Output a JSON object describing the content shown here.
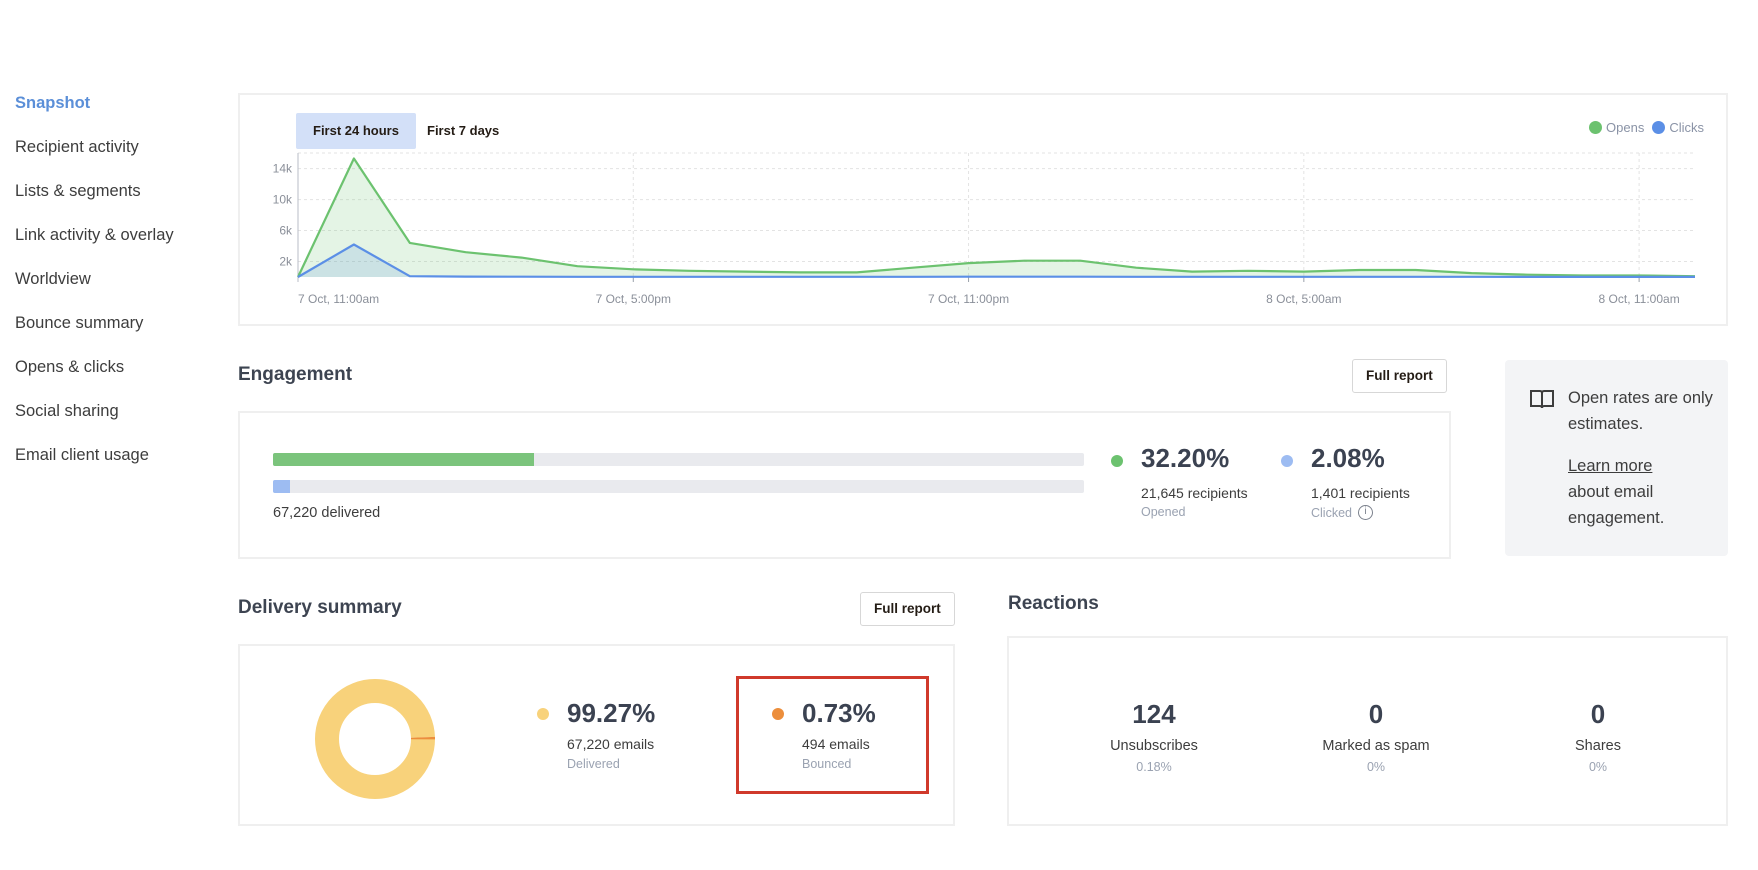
{
  "sidebar": {
    "items": [
      {
        "label": "Snapshot",
        "active": true
      },
      {
        "label": "Recipient activity"
      },
      {
        "label": "Lists & segments"
      },
      {
        "label": "Link activity & overlay"
      },
      {
        "label": "Worldview"
      },
      {
        "label": "Bounce summary"
      },
      {
        "label": "Opens & clicks"
      },
      {
        "label": "Social sharing"
      },
      {
        "label": "Email client usage"
      }
    ]
  },
  "activity_chart": {
    "tabs": [
      {
        "label": "First 24 hours",
        "active": true
      },
      {
        "label": "First 7 days",
        "active": false
      }
    ],
    "legend": [
      {
        "label": "Opens",
        "color": "#6cc26f"
      },
      {
        "label": "Clicks",
        "color": "#5b8fe6"
      }
    ]
  },
  "chart_data": {
    "type": "area",
    "title": "",
    "xlabel": "",
    "ylabel": "",
    "x_tick_labels": [
      "7 Oct, 11:00am",
      "7 Oct, 5:00pm",
      "7 Oct, 11:00pm",
      "8 Oct, 5:00am",
      "8 Oct, 11:00am"
    ],
    "x_tick_hours": [
      0,
      6,
      12,
      18,
      24
    ],
    "y_tick_labels": [
      "2k",
      "6k",
      "10k",
      "14k"
    ],
    "y_ticks": [
      2000,
      6000,
      10000,
      14000
    ],
    "ylim": [
      0,
      15500
    ],
    "x_range_hours": [
      0,
      25
    ],
    "grid": true,
    "legend_position": "top-right",
    "x_hours": [
      0,
      1,
      2,
      3,
      4,
      5,
      6,
      7,
      8,
      9,
      10,
      11,
      12,
      13,
      14,
      15,
      16,
      17,
      18,
      19,
      20,
      21,
      22,
      23,
      24,
      25
    ],
    "series": [
      {
        "name": "Opens",
        "color": "#6cc26f",
        "values": [
          0,
          15300,
          4400,
          3200,
          2500,
          1400,
          1000,
          800,
          700,
          600,
          600,
          1200,
          1800,
          2100,
          2100,
          1200,
          700,
          800,
          700,
          900,
          900,
          500,
          300,
          200,
          200,
          100
        ]
      },
      {
        "name": "Clicks",
        "color": "#5b8fe6",
        "values": [
          0,
          4200,
          100,
          50,
          40,
          30,
          30,
          20,
          20,
          20,
          20,
          30,
          40,
          40,
          40,
          30,
          20,
          20,
          20,
          20,
          20,
          20,
          10,
          10,
          10,
          10
        ]
      }
    ]
  },
  "engagement": {
    "title": "Engagement",
    "full_report_label": "Full report",
    "delivered_text": "67,220 delivered",
    "opened": {
      "pct": "32.20%",
      "fraction": 0.322,
      "recipients": "21,645 recipients",
      "label": "Opened",
      "color": "#6cc26f"
    },
    "clicked": {
      "pct": "2.08%",
      "fraction": 0.0208,
      "recipients": "1,401 recipients",
      "label": "Clicked",
      "color": "#9dbcf2"
    }
  },
  "info_box": {
    "text": "Open rates are only estimates.",
    "link": "Learn more",
    "tail": "about email engagement."
  },
  "delivery": {
    "title": "Delivery summary",
    "full_report_label": "Full report",
    "delivered": {
      "pct": "99.27%",
      "fraction": 0.9927,
      "emails": "67,220 emails",
      "label": "Delivered",
      "color": "#f8d27b"
    },
    "bounced": {
      "pct": "0.73%",
      "fraction": 0.0073,
      "emails": "494 emails",
      "label": "Bounced",
      "color": "#ec8e3c"
    }
  },
  "reactions": {
    "title": "Reactions",
    "items": [
      {
        "value": "124",
        "label": "Unsubscribes",
        "pct": "0.18%"
      },
      {
        "value": "0",
        "label": "Marked as spam",
        "pct": "0%"
      },
      {
        "value": "0",
        "label": "Shares",
        "pct": "0%"
      }
    ]
  }
}
